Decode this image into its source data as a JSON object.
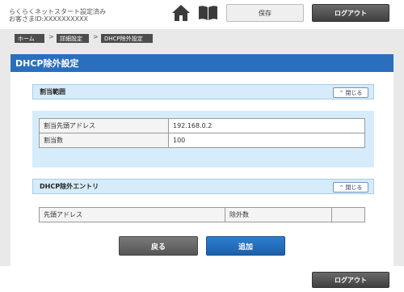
{
  "header": {
    "status_line1": "らくらくネットスタート設定済み",
    "status_line2": "お客さまID:XXXXXXXXXX",
    "home_icon": "home-icon",
    "manual_icon": "book-icon",
    "save_label": "保存",
    "logout_label": "ログアウト"
  },
  "breadcrumb": {
    "items": [
      "ホーム",
      "詳細設定",
      "DHCP除外設定"
    ],
    "separator": ">"
  },
  "page": {
    "title": "DHCP除外設定"
  },
  "allocation": {
    "heading": "割当範囲",
    "toggle_label": "閉じる",
    "rows": [
      {
        "key": "割当先頭アドレス",
        "value": "192.168.0.2"
      },
      {
        "key": "割当数",
        "value": "100"
      }
    ]
  },
  "exclusion": {
    "heading": "DHCP除外エントリ",
    "toggle_label": "閉じる",
    "columns": [
      "先頭アドレス",
      "除外数",
      ""
    ]
  },
  "actions": {
    "back_label": "戻る",
    "add_label": "追加"
  },
  "footer": {
    "logout_label": "ログアウト"
  },
  "colors": {
    "title_bar": "#2a6fbd",
    "section_bg": "#d6ecfb",
    "add_button": "#2d7fd0"
  }
}
